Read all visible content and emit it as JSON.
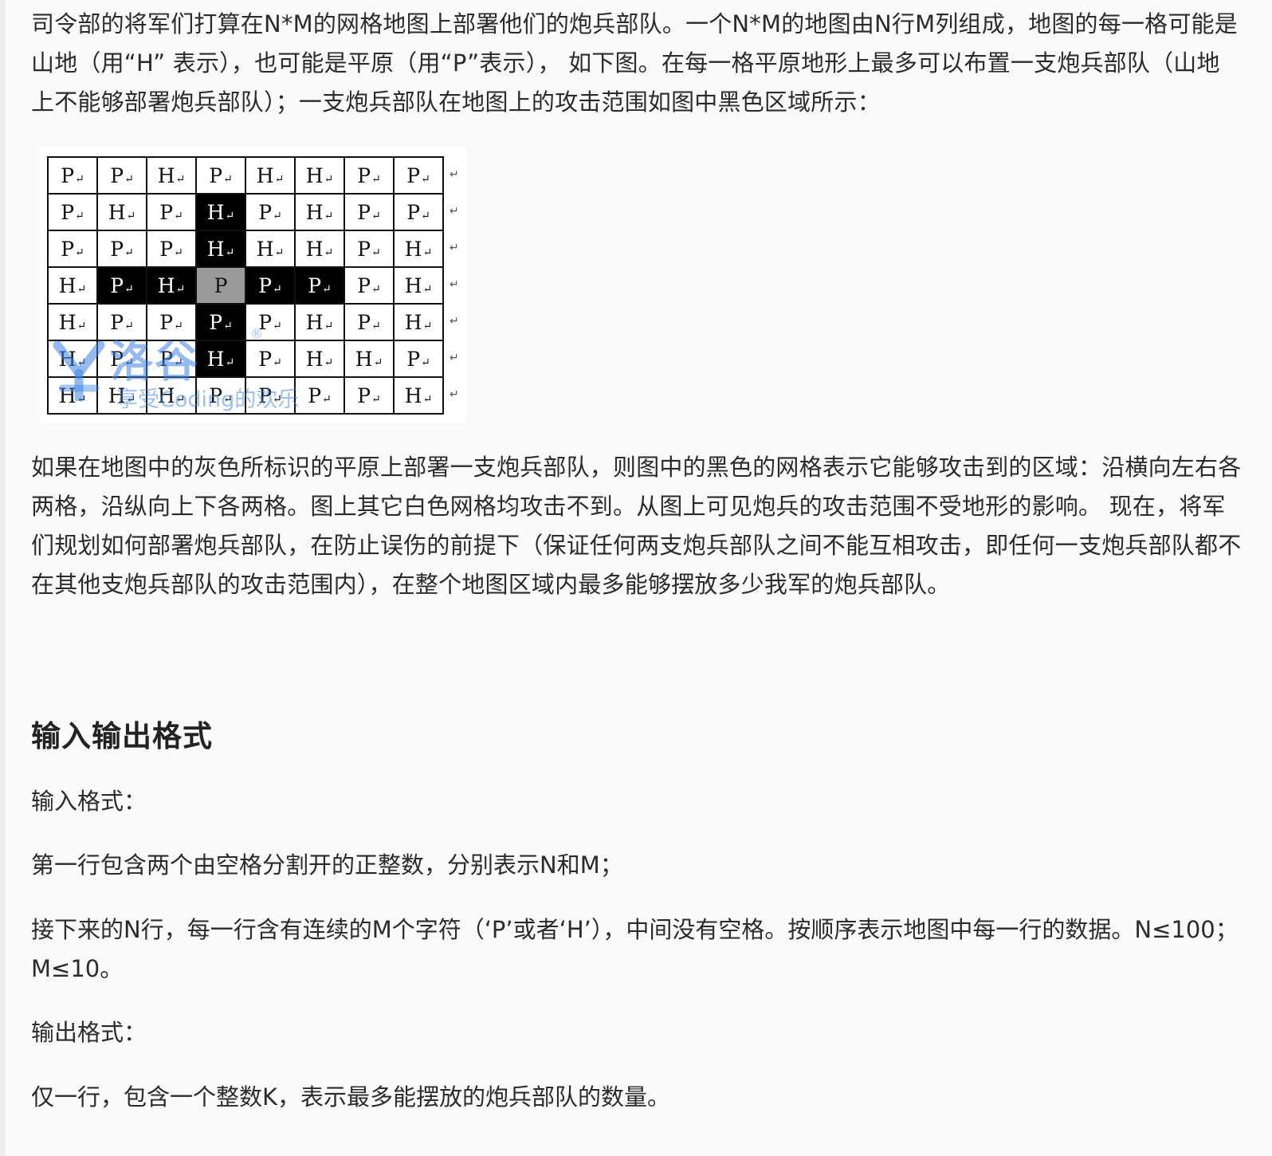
{
  "intro": {
    "text": "司令部的将军们打算在N*M的网格地图上部署他们的炮兵部队。一个N*M的地图由N行M列组成，地图的每一格可能是山地（用“H” 表示），也可能是平原（用“P”表示），  如下图。在每一格平原地形上最多可以布置一支炮兵部队（山地上不能够部署炮兵部队）；一支炮兵部队在地图上的攻击范围如图中黑色区域所示："
  },
  "figure": {
    "return_mark": "↵",
    "rows": [
      [
        "P",
        "P",
        "H",
        "P",
        "H",
        "H",
        "P",
        "P"
      ],
      [
        "P",
        "H",
        "P",
        "H",
        "P",
        "H",
        "P",
        "P"
      ],
      [
        "P",
        "P",
        "P",
        "H",
        "H",
        "H",
        "P",
        "H"
      ],
      [
        "H",
        "P",
        "H",
        "P",
        "P",
        "P",
        "P",
        "H"
      ],
      [
        "H",
        "P",
        "P",
        "P",
        "P",
        "H",
        "P",
        "H"
      ],
      [
        "H",
        "P",
        "P",
        "H",
        "P",
        "H",
        "H",
        "P"
      ],
      [
        "H",
        "H",
        "H",
        "P",
        "P",
        "P",
        "P",
        "H"
      ]
    ],
    "shading": [
      [
        "w",
        "w",
        "w",
        "w",
        "w",
        "w",
        "w",
        "w"
      ],
      [
        "w",
        "w",
        "w",
        "b",
        "w",
        "w",
        "w",
        "w"
      ],
      [
        "w",
        "w",
        "w",
        "b",
        "w",
        "w",
        "w",
        "w"
      ],
      [
        "w",
        "b",
        "b",
        "g",
        "b",
        "b",
        "w",
        "w"
      ],
      [
        "w",
        "w",
        "w",
        "b",
        "w",
        "w",
        "w",
        "w"
      ],
      [
        "w",
        "w",
        "w",
        "b",
        "w",
        "w",
        "w",
        "w"
      ],
      [
        "w",
        "w",
        "w",
        "w",
        "w",
        "w",
        "w",
        "w"
      ]
    ],
    "watermark": {
      "brand": "洛谷",
      "tagline": "享受Coding的欢乐",
      "mark": "®",
      "color": "#3c82e6"
    }
  },
  "explanation": {
    "text": "如果在地图中的灰色所标识的平原上部署一支炮兵部队，则图中的黑色的网格表示它能够攻击到的区域：沿横向左右各两格，沿纵向上下各两格。图上其它白色网格均攻击不到。从图上可见炮兵的攻击范围不受地形的影响。 现在，将军们规划如何部署炮兵部队，在防止误伤的前提下（保证任何两支炮兵部队之间不能互相攻击，即任何一支炮兵部队都不在其他支炮兵部队的攻击范围内），在整个地图区域内最多能够摆放多少我军的炮兵部队。"
  },
  "io": {
    "heading": "输入输出格式",
    "input_label": "输入格式：",
    "input_line1": "第一行包含两个由空格分割开的正整数，分别表示N和M；",
    "input_line2": "接下来的N行，每一行含有连续的M个字符（‘P’或者‘H’），中间没有空格。按顺序表示地图中每一行的数据。N≤100；M≤10。",
    "output_label": "输出格式：",
    "output_line1": "仅一行，包含一个整数K，表示最多能摆放的炮兵部队的数量。"
  }
}
